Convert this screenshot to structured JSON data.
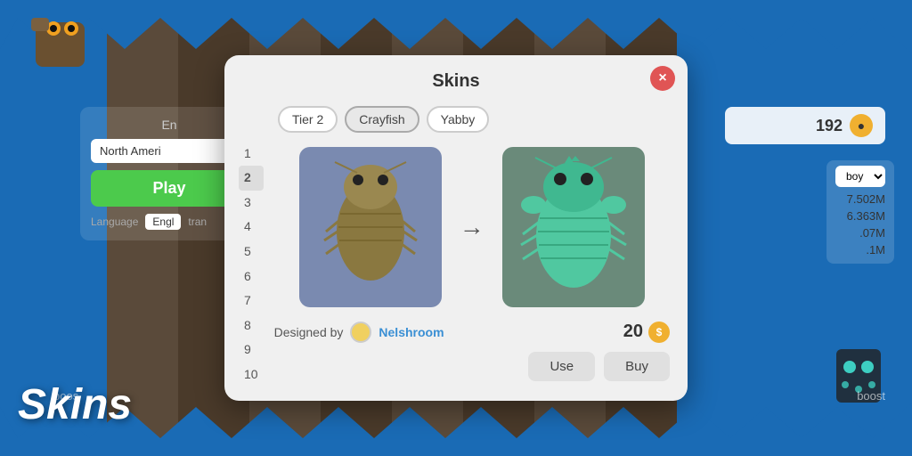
{
  "background": {
    "color": "#1a6bb5",
    "stripe_color_odd": "#5a4a3a",
    "stripe_color_even": "#4a3a2a"
  },
  "modal": {
    "title": "Skins",
    "close_label": "×",
    "tabs": [
      {
        "id": "tier2",
        "label": "Tier 2",
        "active": false
      },
      {
        "id": "crayfish",
        "label": "Crayfish",
        "active": true
      },
      {
        "id": "yabby",
        "label": "Yabby",
        "active": false
      }
    ],
    "numbers": [
      "1",
      "2",
      "3",
      "4",
      "5",
      "6",
      "7",
      "8",
      "9",
      "10"
    ],
    "selected_number": "2",
    "arrow": "→",
    "designer_label": "Designed by",
    "designer_avatar_color": "#f0d060",
    "designer_name": "Nelshroom",
    "price": "20",
    "coin_label": "$",
    "use_button": "Use",
    "buy_button": "Buy"
  },
  "game_left": {
    "label": "En",
    "region": "North Ameri",
    "play_label": "Play",
    "language_label": "Language",
    "language_value": "Engl",
    "language_sub": "tran"
  },
  "game_right": {
    "coins": "192",
    "coin_icon": "●",
    "filter_label": "boy",
    "scores": [
      "7.502M",
      "6.363M",
      ".07M",
      ".1M"
    ]
  },
  "watermark": {
    "skins_label": "Skins"
  },
  "boost_left": "boos",
  "boost_right": "boost"
}
